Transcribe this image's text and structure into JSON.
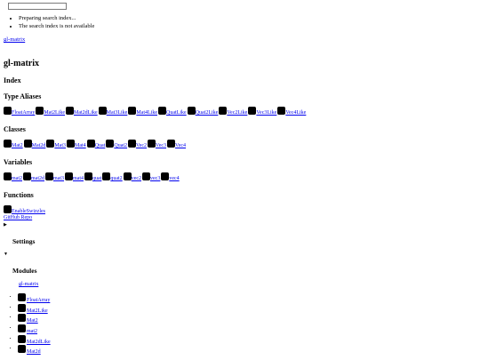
{
  "search": {
    "placeholder": "",
    "status": [
      "Preparing search index...",
      "The search index is not available"
    ]
  },
  "breadcrumb": "gl-matrix",
  "title": "gl-matrix",
  "index_heading": "Index",
  "sections": {
    "type_aliases": {
      "heading": "Type Aliases",
      "items": [
        "FloatArray",
        "Mat2Like",
        "Mat2dLike",
        "Mat3Like",
        "Mat4Like",
        "QuatLike",
        "Quat2Like",
        "Vec2Like",
        "Vec3Like",
        "Vec4Like"
      ]
    },
    "classes": {
      "heading": "Classes",
      "items": [
        "Mat2",
        "Mat2d",
        "Mat3",
        "Mat4",
        "Quat",
        "Quat2",
        "Vec2",
        "Vec3",
        "Vec4"
      ]
    },
    "variables": {
      "heading": "Variables",
      "items": [
        "mat2",
        "mat2d",
        "mat3",
        "mat4",
        "quat",
        "quat2",
        "vec2",
        "vec3",
        "vec4"
      ]
    },
    "functions": {
      "heading": "Functions",
      "items": [
        "EnableSwizzles"
      ]
    }
  },
  "github_link": "GitHub Repo",
  "settings": {
    "heading": "Settings",
    "toggle": "▶"
  },
  "modules": {
    "heading": "Modules",
    "toggle": "▼",
    "root_link": "gl-matrix",
    "items": [
      "FloatArray",
      "Mat2Like",
      "Mat2",
      "mat2",
      "Mat2dLike",
      "Mat2d"
    ]
  },
  "icon_names": {
    "member": "kind-icon"
  }
}
